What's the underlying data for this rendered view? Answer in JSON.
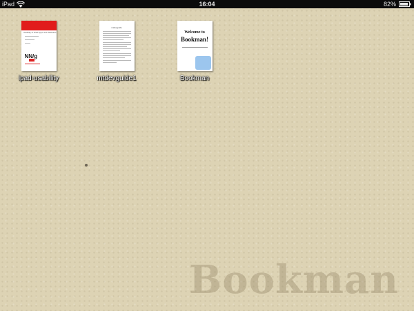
{
  "status_bar": {
    "carrier": "iPad",
    "time": "16:04",
    "battery": "82%"
  },
  "books": [
    {
      "title": "ipad-usability",
      "cover_header": "Usability of iPad Apps and Websites"
    },
    {
      "title": "mtdevguide1",
      "cover_header": "mtdevguide"
    },
    {
      "title": "Bookman",
      "cover_line1": "Welcome to",
      "cover_line2": "Bookman!"
    }
  ],
  "watermark": "Bookman",
  "colors": {
    "background": "#ddd3b4",
    "status_bar": "#0b0b0b",
    "cover1_band": "#e11c1c",
    "cover3_box": "#9cc6ee"
  }
}
